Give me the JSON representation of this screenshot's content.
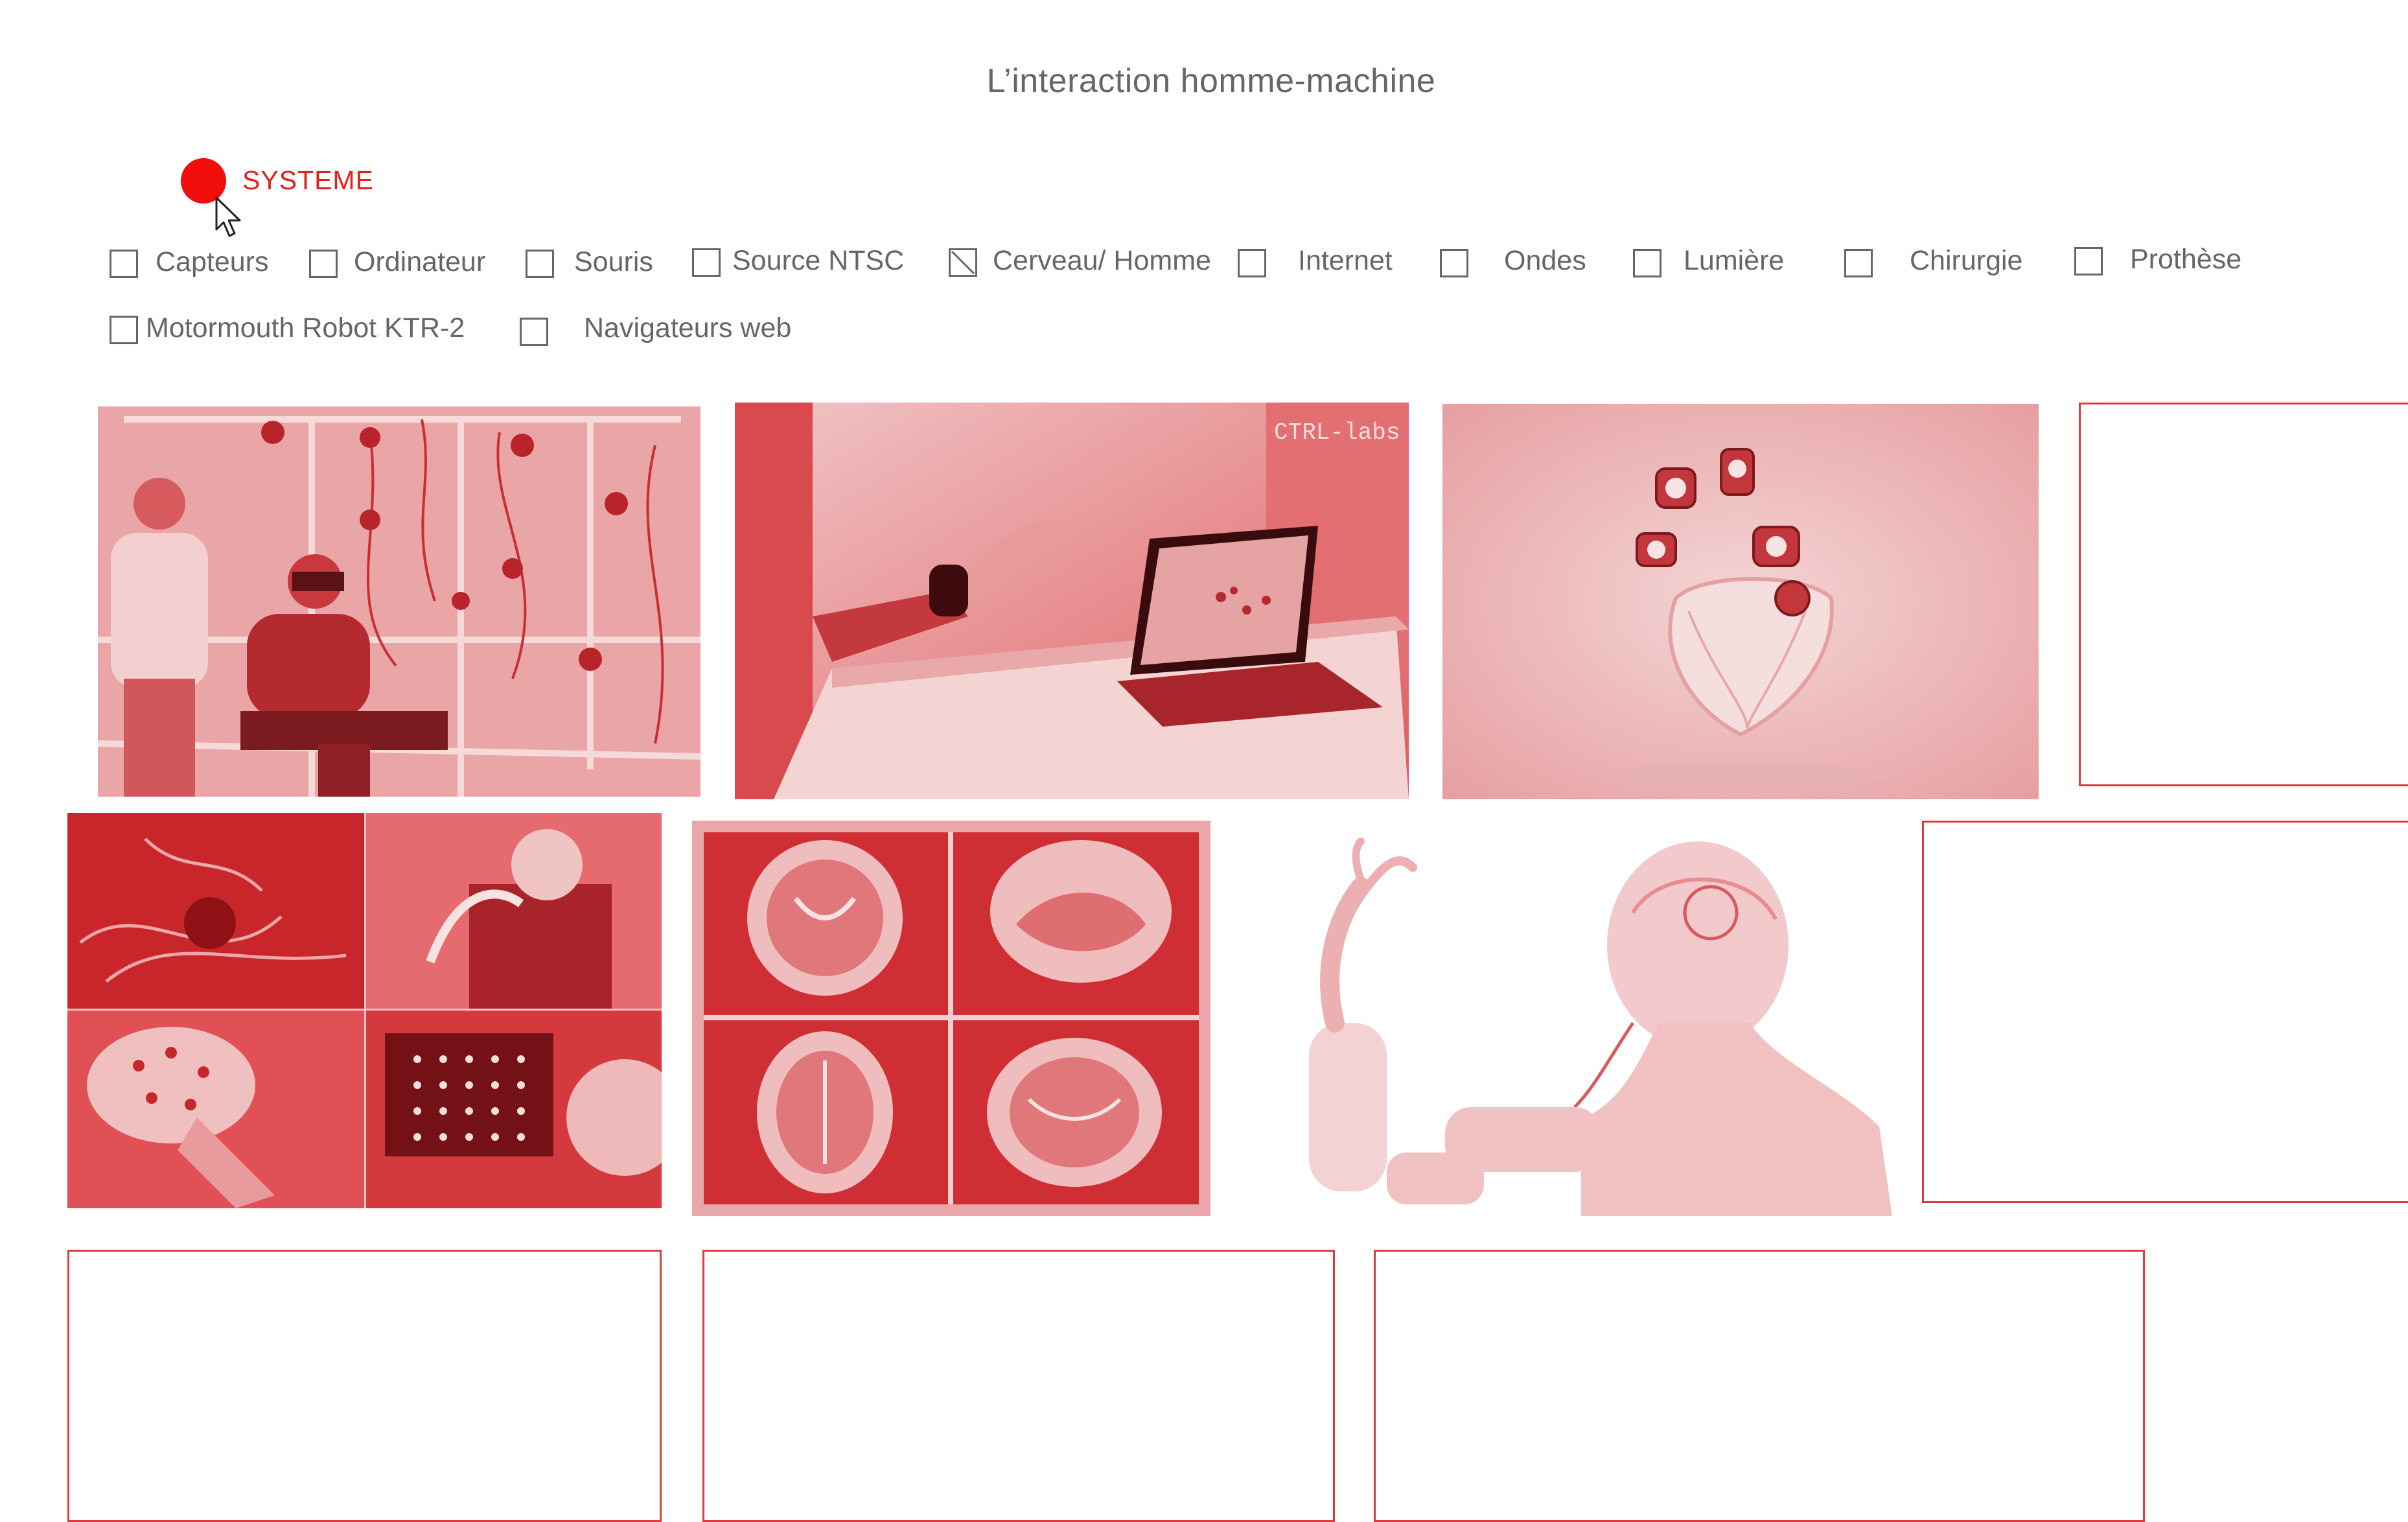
{
  "page": {
    "title": "L’interaction homme-machine",
    "accent_color": "#e2393d",
    "dot_color": "#f20d0d"
  },
  "system": {
    "label": "SYSTEME",
    "dot_icon": "record-dot-icon",
    "cursor_icon": "mouse-pointer-icon"
  },
  "filters": [
    {
      "label": "Capteurs",
      "checked": false
    },
    {
      "label": "Ordinateur",
      "checked": false
    },
    {
      "label": "Souris",
      "checked": false
    },
    {
      "label": "Source NTSC",
      "checked": false
    },
    {
      "label": "Cerveau/ Homme",
      "checked": true
    },
    {
      "label": "Internet",
      "checked": false
    },
    {
      "label": "Ondes",
      "checked": false
    },
    {
      "label": "Lumière",
      "checked": false
    },
    {
      "label": "Chirurgie",
      "checked": false
    },
    {
      "label": "Prothèse",
      "checked": false
    },
    {
      "label": "Motormouth Robot KTR-2",
      "checked": false
    },
    {
      "label": "Navigateurs web",
      "checked": false
    }
  ],
  "gallery": {
    "ctrl_labs_sign": "CTRL-labs",
    "images": [
      {
        "name": "vr-motion-capture-photo",
        "type": "photo"
      },
      {
        "name": "ctrl-labs-wristband-photo",
        "type": "photo"
      },
      {
        "name": "artificial-heart-photo",
        "type": "photo"
      },
      {
        "name": "empty-image-slot",
        "type": "empty"
      },
      {
        "name": "bci-collage-photo",
        "type": "photo"
      },
      {
        "name": "brain-mri-scans-photo",
        "type": "photo"
      },
      {
        "name": "prosthetic-arm-illustration",
        "type": "photo"
      },
      {
        "name": "empty-image-slot",
        "type": "empty"
      },
      {
        "name": "empty-image-slot",
        "type": "empty"
      },
      {
        "name": "empty-image-slot",
        "type": "empty"
      },
      {
        "name": "empty-image-slot",
        "type": "empty"
      }
    ]
  }
}
